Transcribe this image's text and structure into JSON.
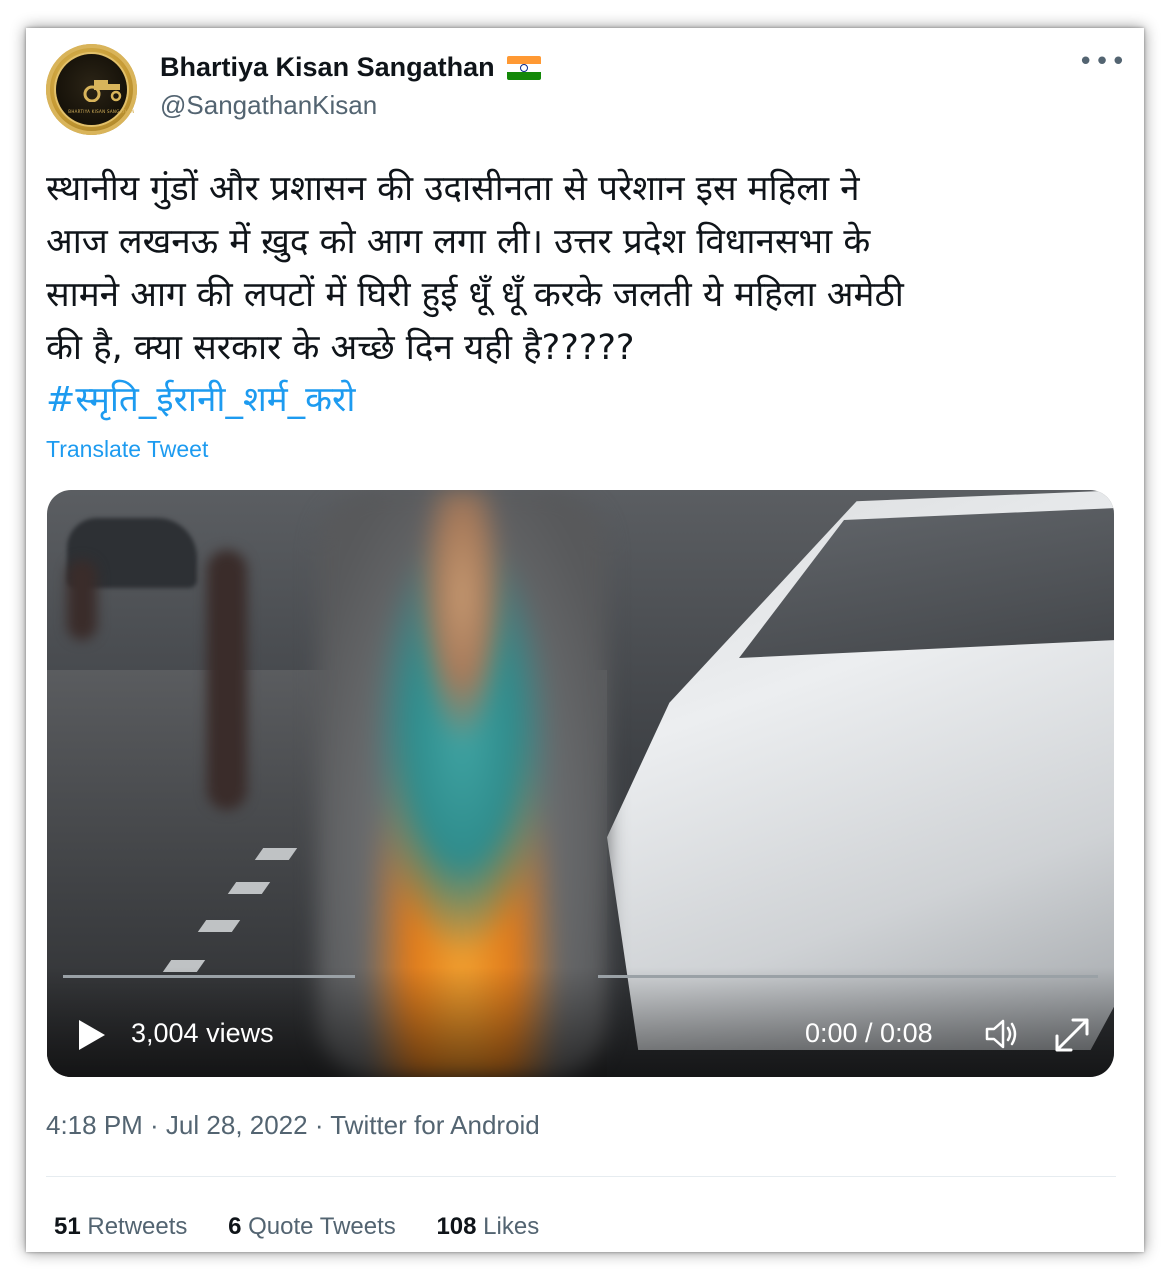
{
  "author": {
    "display_name": "Bhartiya Kisan Sangathan",
    "handle": "@SangathanKisan",
    "avatar_text": "BHARTIYA KISAN SANGATHAN",
    "flag_icon": "india-flag-icon",
    "more_icon": "more-horizontal-icon"
  },
  "tweet": {
    "lines": [
      "स्थानीय गुंडों और प्रशासन की उदासीनता से परेशान इस महिला ने",
      "आज लखनऊ में ख़ुद को आग लगा ली। उत्तर प्रदेश विधानसभा के",
      "सामने आग की लपटों में घिरी हुई धूँ धूँ करके जलती ये महिला अमेठी",
      "की है, क्या सरकार के अच्छे दिन यही है?????"
    ],
    "hashtag": "#स्मृति_ईरानी_शर्म_करो",
    "translate_label": "Translate Tweet"
  },
  "video": {
    "views": "3,004 views",
    "time": "0:00 / 0:08",
    "progress_fraction": 0.0,
    "icons": [
      "play-icon",
      "volume-icon",
      "expand-icon"
    ]
  },
  "meta": {
    "timestamp": "4:18 PM · Jul 28, 2022 · Twitter for Android"
  },
  "stats": [
    {
      "count": "51",
      "label": "Retweets"
    },
    {
      "count": "6",
      "label": "Quote Tweets"
    },
    {
      "count": "108",
      "label": "Likes"
    }
  ],
  "colors": {
    "accent": "#1d9bf0",
    "text": "#0f1419",
    "secondary": "#536471"
  }
}
